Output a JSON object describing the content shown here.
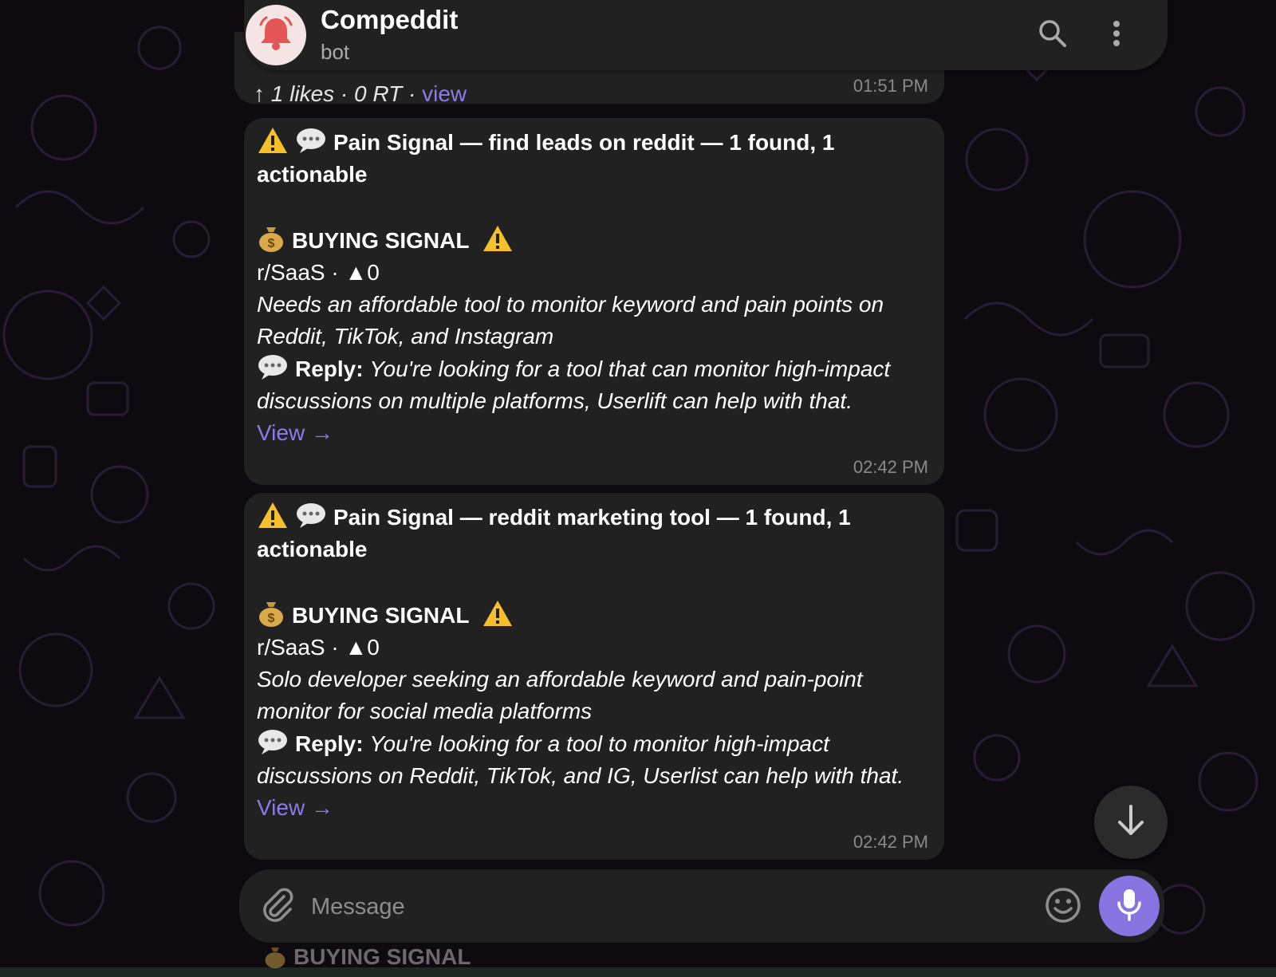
{
  "header": {
    "title": "Compeddit",
    "status": "bot",
    "avatar_icon": "bell-icon",
    "avatar_color": "#f4e4e4",
    "accent": "#e45656"
  },
  "previous_message": {
    "stats_text": "↑ 1 likes · 0 RT ·",
    "link": "view",
    "time": "01:51 PM"
  },
  "messages": [
    {
      "title": "Pain Signal — find leads on reddit — 1 found, 1 actionable",
      "signal": "BUYING SIGNAL",
      "meta": "r/SaaS · ▲0",
      "summary": "Needs an affordable tool to monitor keyword and pain points on Reddit, TikTok, and Instagram",
      "reply_label": "Reply:",
      "reply_text": "You're looking for a tool that can monitor high-impact discussions on multiple platforms, Userlift can help with that.",
      "link": "View →",
      "time": "02:42 PM"
    },
    {
      "title": "Pain Signal — reddit marketing tool — 1 found, 1 actionable",
      "signal": "BUYING SIGNAL",
      "meta": "r/SaaS · ▲0",
      "summary": "Solo developer seeking an affordable keyword and pain-point monitor for social media platforms",
      "reply_label": "Reply:",
      "reply_text": "You're looking for a tool to monitor high-impact discussions on Reddit, TikTok, and IG, Userlist can help with that.",
      "link": "View →",
      "time": "02:42 PM"
    }
  ],
  "peek_text": "BUYING SIGNAL",
  "composer": {
    "placeholder": "Message"
  },
  "colors": {
    "bubble": "#212121",
    "link": "#8b7bea",
    "mic_button": "#8774e1",
    "background": "#0d0a10"
  }
}
